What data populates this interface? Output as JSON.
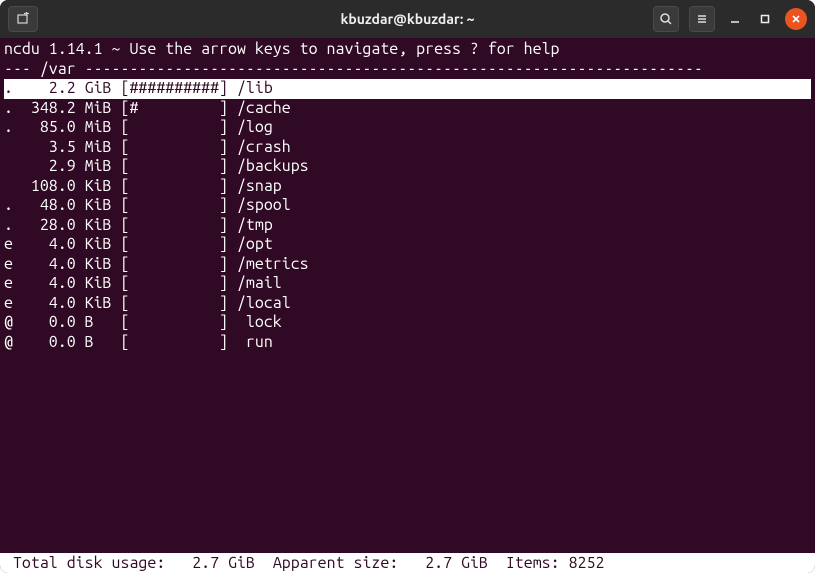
{
  "titlebar": {
    "title": "kbuzdar@kbuzdar: ~"
  },
  "header": "ncdu 1.14.1 ~ Use the arrow keys to navigate, press ? for help",
  "pathline": "--- /var ---------------------------------------------------------------------",
  "rows": [
    {
      "flag": ".",
      "size": "2.2",
      "unit": "GiB",
      "bar": "##########",
      "name": "/lib",
      "selected": true
    },
    {
      "flag": ".",
      "size": "348.2",
      "unit": "MiB",
      "bar": "#         ",
      "name": "/cache",
      "selected": false
    },
    {
      "flag": ".",
      "size": "85.0",
      "unit": "MiB",
      "bar": "          ",
      "name": "/log",
      "selected": false
    },
    {
      "flag": " ",
      "size": "3.5",
      "unit": "MiB",
      "bar": "          ",
      "name": "/crash",
      "selected": false
    },
    {
      "flag": " ",
      "size": "2.9",
      "unit": "MiB",
      "bar": "          ",
      "name": "/backups",
      "selected": false
    },
    {
      "flag": " ",
      "size": "108.0",
      "unit": "KiB",
      "bar": "          ",
      "name": "/snap",
      "selected": false
    },
    {
      "flag": ".",
      "size": "48.0",
      "unit": "KiB",
      "bar": "          ",
      "name": "/spool",
      "selected": false
    },
    {
      "flag": ".",
      "size": "28.0",
      "unit": "KiB",
      "bar": "          ",
      "name": "/tmp",
      "selected": false
    },
    {
      "flag": "e",
      "size": "4.0",
      "unit": "KiB",
      "bar": "          ",
      "name": "/opt",
      "selected": false
    },
    {
      "flag": "e",
      "size": "4.0",
      "unit": "KiB",
      "bar": "          ",
      "name": "/metrics",
      "selected": false
    },
    {
      "flag": "e",
      "size": "4.0",
      "unit": "KiB",
      "bar": "          ",
      "name": "/mail",
      "selected": false
    },
    {
      "flag": "e",
      "size": "4.0",
      "unit": "KiB",
      "bar": "          ",
      "name": "/local",
      "selected": false
    },
    {
      "flag": "@",
      "size": "0.0",
      "unit": "B",
      "bar": "          ",
      "name": " lock",
      "selected": false
    },
    {
      "flag": "@",
      "size": "0.0",
      "unit": "B",
      "bar": "          ",
      "name": " run",
      "selected": false
    }
  ],
  "footer": {
    "total_label": "Total disk usage:",
    "total_value": "2.7 GiB",
    "apparent_label": "Apparent size:",
    "apparent_value": "2.7 GiB",
    "items_label": "Items:",
    "items_value": "8252"
  }
}
